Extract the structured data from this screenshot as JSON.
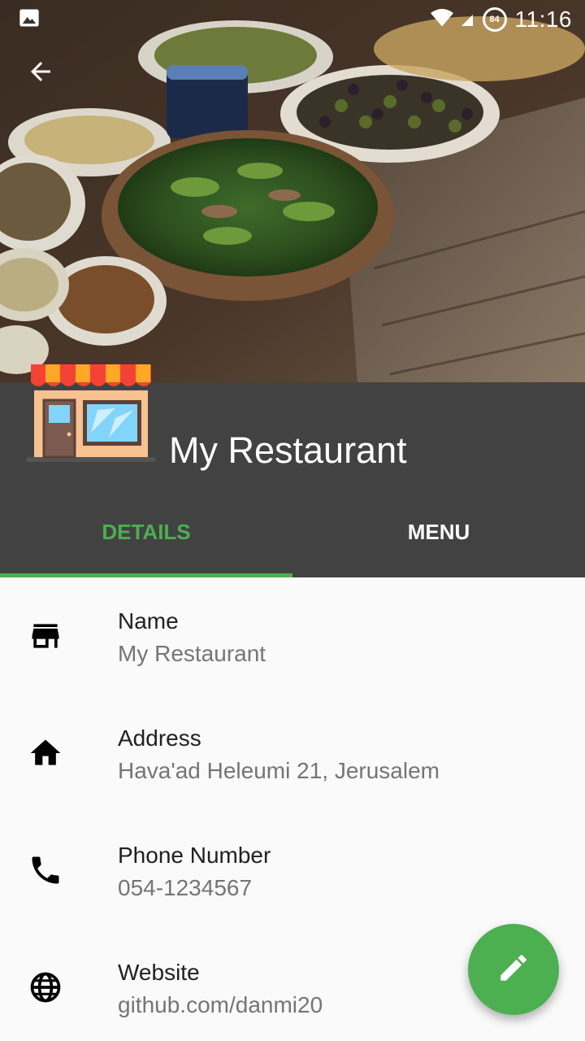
{
  "status_bar": {
    "time": "11:16",
    "battery_level": "84",
    "icons": [
      "image-notification-icon",
      "wifi-icon",
      "cell-signal-icon",
      "battery-icon"
    ]
  },
  "header": {
    "back_icon": "arrow-back-icon",
    "image": "food-table-photo",
    "logo": "storefront-logo",
    "title": "My Restaurant"
  },
  "tabs": [
    {
      "label": "DETAILS",
      "active": true
    },
    {
      "label": "MENU",
      "active": false
    }
  ],
  "details": [
    {
      "icon": "store-icon",
      "label": "Name",
      "value": "My Restaurant"
    },
    {
      "icon": "home-icon",
      "label": "Address",
      "value": "Hava'ad Heleumi 21, Jerusalem"
    },
    {
      "icon": "phone-icon",
      "label": "Phone Number",
      "value": "054-1234567"
    },
    {
      "icon": "globe-icon",
      "label": "Website",
      "value": "github.com/danmi20"
    }
  ],
  "fab": {
    "icon": "edit-pencil-icon"
  },
  "colors": {
    "accent": "#4caf50",
    "header_band": "#424242",
    "background": "#fafafa",
    "label": "#212121",
    "value": "#757575"
  }
}
